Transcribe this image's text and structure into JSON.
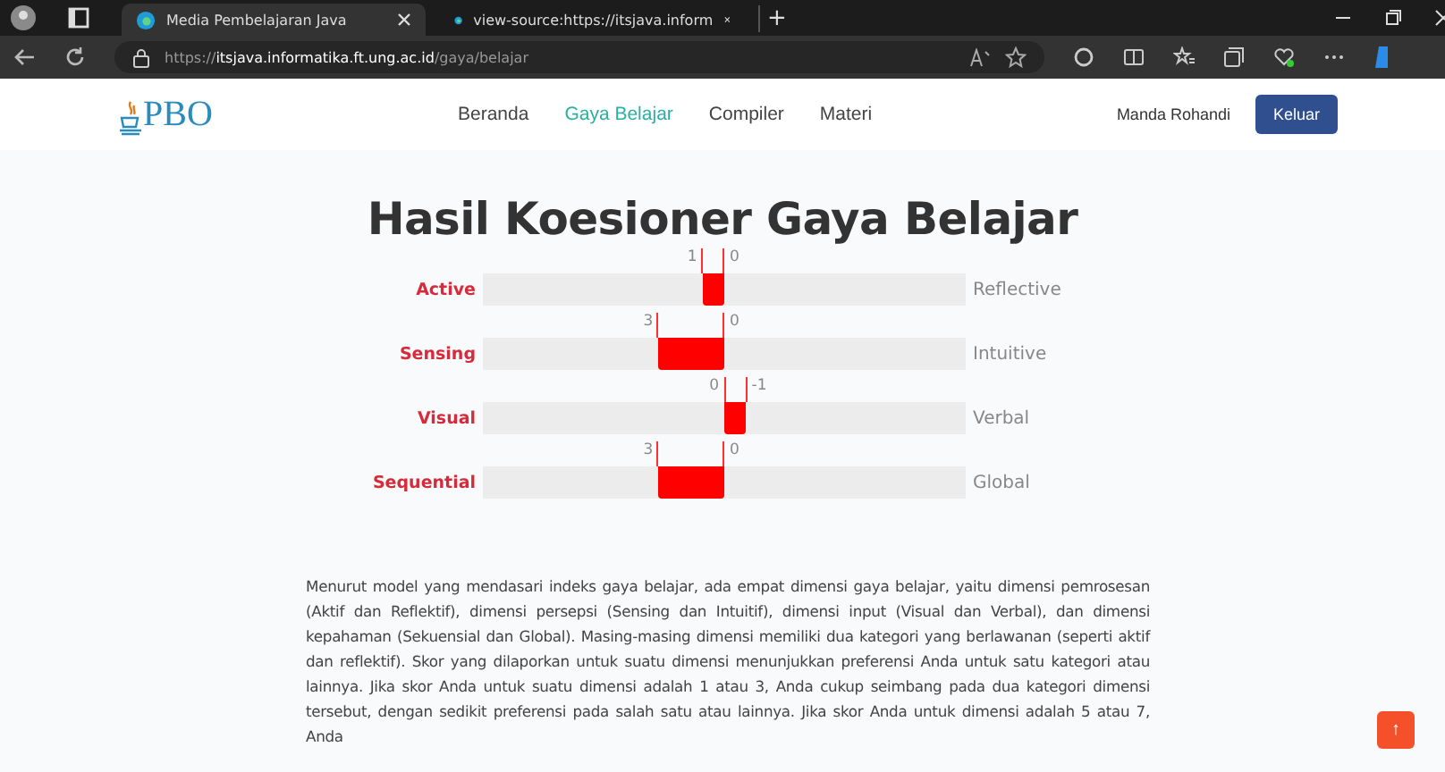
{
  "browser": {
    "tabs": [
      {
        "title": "Media Pembelajaran Java",
        "selected": true
      },
      {
        "title": "view-source:https://itsjava.inform",
        "selected": false
      }
    ],
    "new_tab": "+",
    "url": {
      "scheme": "https://",
      "host": "itsjava.informatika.ft.ung.ac.id",
      "path": "/gaya/belajar"
    }
  },
  "navbar": {
    "logo": "PBO",
    "links": [
      {
        "label": "Beranda",
        "selected": false
      },
      {
        "label": "Gaya Belajar",
        "selected": true
      },
      {
        "label": "Compiler",
        "selected": false
      },
      {
        "label": "Materi",
        "selected": false
      }
    ],
    "user": "Manda Rohandi",
    "logout": "Keluar"
  },
  "title": "Hasil Koesioner Gaya Belajar",
  "scales": [
    {
      "left": "Active",
      "right": "Reflective",
      "left_score": "1",
      "right_score": "0",
      "kind": "left",
      "level": 0.0909
    },
    {
      "left": "Sensing",
      "right": "Intuitive",
      "left_score": "3",
      "right_score": "0",
      "kind": "left",
      "level": 0.2727
    },
    {
      "left": "Visual",
      "right": "Verbal",
      "left_score": "0",
      "right_score": "-1",
      "kind": "right",
      "level": 0.0909
    },
    {
      "left": "Sequential",
      "right": "Global",
      "left_score": "3",
      "right_score": "0",
      "kind": "left",
      "level": 0.2727
    }
  ],
  "description": "Menurut model yang mendasari indeks gaya belajar, ada empat dimensi gaya belajar, yaitu dimensi pemrosesan (Aktif dan Reflektif), dimensi persepsi (Sensing dan Intuitif), dimensi input (Visual dan Verbal), dan dimensi kepahaman (Sekuensial dan Global). Masing-masing dimensi memiliki dua kategori yang berlawanan (seperti aktif dan reflektif). Skor yang dilaporkan untuk suatu dimensi menunjukkan preferensi Anda untuk satu kategori atau lainnya. Jika skor Anda untuk suatu dimensi adalah 1 atau 3, Anda cukup seimbang pada dua kategori dimensi tersebut, dengan sedikit preferensi pada salah satu atau lainnya. Jika skor Anda untuk dimensi adalah 5 atau 7, Anda",
  "scroll_top": "↑"
}
